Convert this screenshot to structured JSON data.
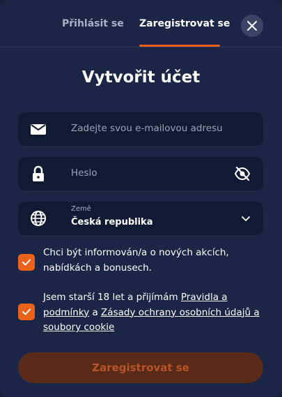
{
  "tabs": {
    "login": "Přihlásit se",
    "register": "Zaregistrovat se"
  },
  "title": "Vytvořit účet",
  "form": {
    "email_placeholder": "Zadejte svou e-mailovou adresu",
    "password_placeholder": "Heslo",
    "country_label": "Země",
    "country_value": "Česká republika"
  },
  "consents": {
    "marketing": {
      "checked": true,
      "text": "Chci být informován/a o nových akcích, nabídkách a bonusech."
    },
    "terms": {
      "checked": true,
      "prefix": "Jsem starší 18 let a přijímám ",
      "link1": "Pravidla a podmínky",
      "middle": " a ",
      "link2": "Zásady ochrany osobních údajů a soubory cookie"
    }
  },
  "submit_label": "Zaregistrovat se",
  "icons": [
    "close-icon",
    "envelope-icon",
    "lock-icon",
    "eye-off-icon",
    "globe-icon",
    "chevron-down-icon",
    "checkmark-icon"
  ],
  "colors": {
    "background": "#1b2646",
    "field": "#111a33",
    "accent": "#e8621a",
    "submit_disabled": "#5a2a18"
  }
}
